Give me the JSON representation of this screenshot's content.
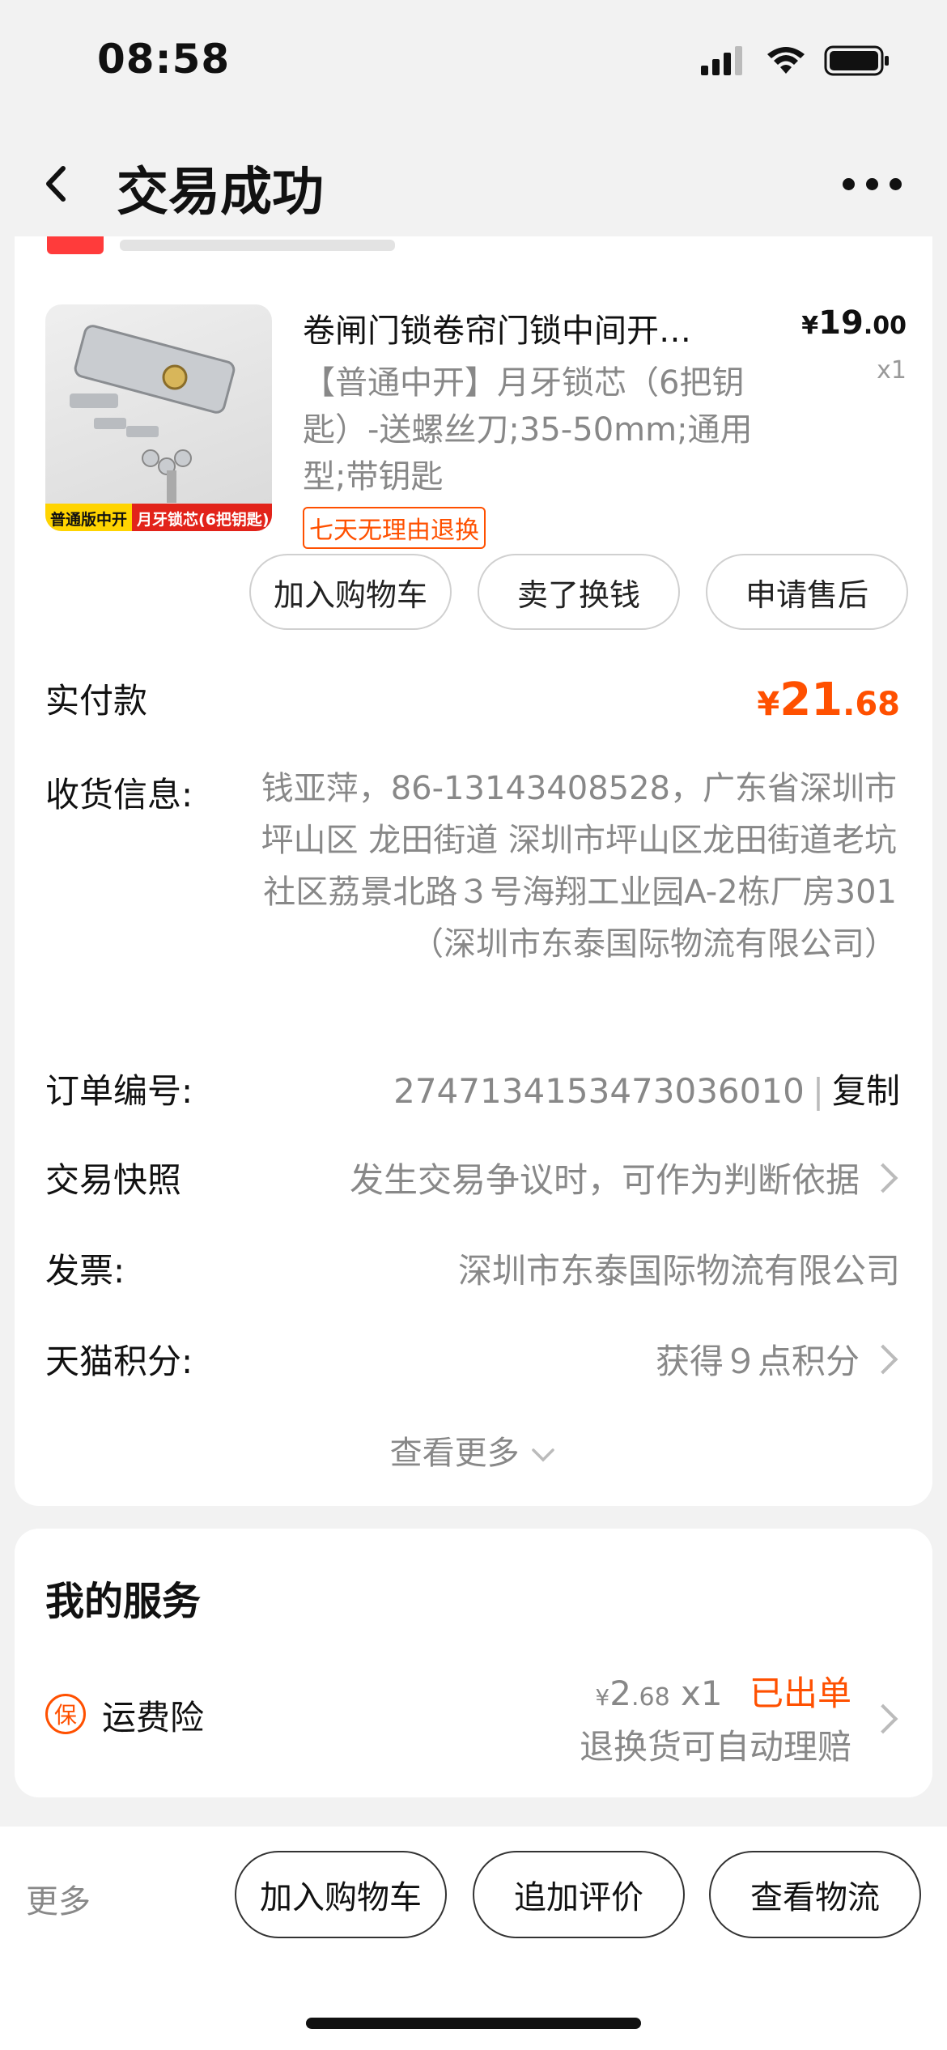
{
  "status_bar": {
    "time": "08:58"
  },
  "nav": {
    "title": "交易成功"
  },
  "product": {
    "title": "卷闸门锁卷帘门锁中间开…",
    "price_symbol": "¥",
    "price_int": "19",
    "price_dec": ".00",
    "qty": "x1",
    "spec": "【普通中开】月牙锁芯（6把钥匙）-送螺丝刀;35-50mm;通用型;带钥匙",
    "tag": "七天无理由退换",
    "image_tag_left": "普通版中开",
    "image_tag_right": "月牙锁芯(6把钥匙)"
  },
  "actions": {
    "add_cart": "加入购物车",
    "resell": "卖了换钱",
    "after_sale": "申请售后"
  },
  "order": {
    "paid_label": "实付款",
    "paid_symbol": "¥",
    "paid_int": "21",
    "paid_dec": ".68",
    "address_label": "收货信息:",
    "address_value": "钱亚萍，86-13143408528，广东省深圳市 坪山区 龙田街道 深圳市坪山区龙田街道老坑社区荔景北路３号海翔工业园A-2栋厂房301（深圳市东泰国际物流有限公司）",
    "order_no_label": "订单编号:",
    "order_no": "2747134153473036010",
    "order_no_sep": "|",
    "copy_label": "复制",
    "snapshot_label": "交易快照",
    "snapshot_value": "发生交易争议时，可作为判断依据",
    "invoice_label": "发票:",
    "invoice_value": "深圳市东泰国际物流有限公司",
    "points_label": "天猫积分:",
    "points_value": "获得９点积分",
    "see_more": "查看更多"
  },
  "service": {
    "title": "我的服务",
    "icon_char": "保",
    "name": "运费险",
    "price_symbol": "¥",
    "price_int": "2",
    "price_dec": ".68",
    "qty": "x1",
    "status": "已出单",
    "desc": "退换货可自动理赔"
  },
  "bottom": {
    "more": "更多",
    "add_cart": "加入购物车",
    "review": "追加评价",
    "logistics": "查看物流"
  },
  "colors": {
    "accent": "#ff5000",
    "background": "#f2f2f2"
  }
}
